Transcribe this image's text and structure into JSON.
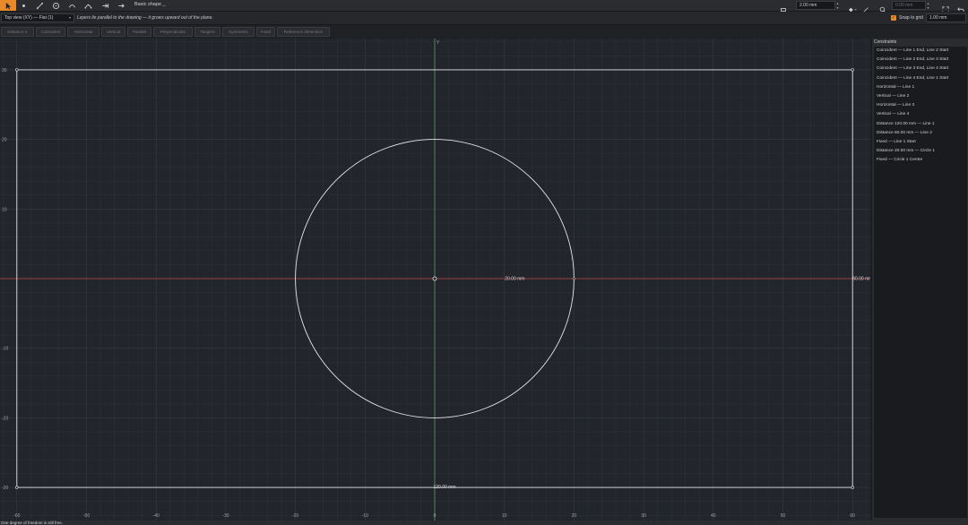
{
  "toolbar": {
    "document_title": "Basic shape _",
    "line_width": "2.00 mm",
    "radius_field": "0.00 mm"
  },
  "view_bar": {
    "view_select": "Top view (XY) — Flat (1)",
    "hint": "Layers lie parallel to the drawing — it grows upward out of the plane.",
    "snap_label": "Snap to grid",
    "snap_checked": true,
    "grid_size": "1.00 mm"
  },
  "constraint_tools": [
    "Distance X",
    "Coincident",
    "Horizontal",
    "Vertical",
    "Parallel",
    "Perpendicular",
    "Tangent",
    "Symmetric",
    "Fixed",
    "Reference dimension"
  ],
  "panel": {
    "title": "Constraints",
    "items": [
      "Coincident — Line 1 End, Line 2 Start",
      "Coincident — Line 2 End, Line 3 Start",
      "Coincident — Line 3 End, Line 4 Start",
      "Coincident — Line 4 End, Line 1 Start",
      "Horizontal — Line 1",
      "Vertical — Line 2",
      "Horizontal — Line 3",
      "Vertical — Line 4",
      "Distance 120.00 mm — Line 1",
      "Distance 60.00 mm — Line 2",
      "Fixed — Line 1 Start",
      "Distance 20.00 mm — Circle 1",
      "Fixed — Circle 1 Centre"
    ]
  },
  "canvas": {
    "y_axis_label": "Y",
    "x_ticks": [
      "-60",
      "-50",
      "-40",
      "-30",
      "-20",
      "-10",
      "0",
      "10",
      "20",
      "30",
      "40",
      "50",
      "60"
    ],
    "y_ticks": [
      "30",
      "20",
      "10",
      "0",
      "-10",
      "-20",
      "-30"
    ],
    "dimension_circle": "20.00 mm",
    "dimension_height": "60.00 mm",
    "dimension_width": "120.00 mm",
    "colors": {
      "x_axis": "#b84a4a",
      "y_axis": "#5f9a64",
      "geometry": "#e6e7ea",
      "grid": "#2f333a",
      "accent": "#e8892b"
    }
  },
  "status": {
    "text": "One degree of freedom is still free."
  }
}
